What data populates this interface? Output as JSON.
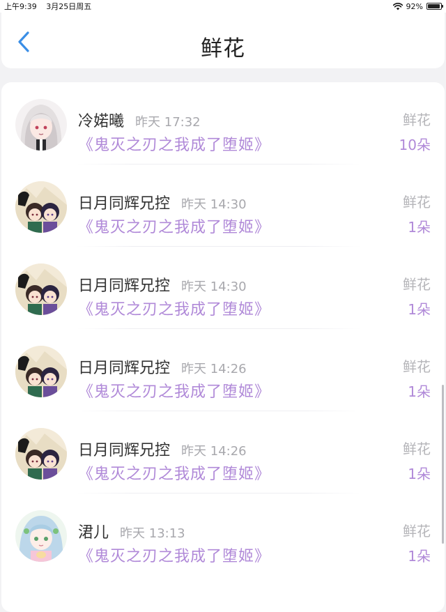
{
  "status_bar": {
    "time": "上午9:39",
    "date": "3月25日周五",
    "battery": "92%",
    "battery_level": 0.92
  },
  "nav": {
    "title": "鲜花",
    "back_icon": "chevron-left-icon",
    "accent_color": "#3a8ee6"
  },
  "rows": [
    {
      "user": "冷婼曦",
      "time": "昨天 17:32",
      "book": "《鬼灭之刃之我成了堕姬》",
      "type": "鲜花",
      "count": "10朵",
      "avatar": "avatar-white-hair-girl"
    },
    {
      "user": "日月同辉兄控",
      "time": "昨天 14:30",
      "book": "《鬼灭之刃之我成了堕姬》",
      "type": "鲜花",
      "count": "1朵",
      "avatar": "avatar-two-chibi"
    },
    {
      "user": "日月同辉兄控",
      "time": "昨天 14:30",
      "book": "《鬼灭之刃之我成了堕姬》",
      "type": "鲜花",
      "count": "1朵",
      "avatar": "avatar-two-chibi"
    },
    {
      "user": "日月同辉兄控",
      "time": "昨天 14:26",
      "book": "《鬼灭之刃之我成了堕姬》",
      "type": "鲜花",
      "count": "1朵",
      "avatar": "avatar-two-chibi"
    },
    {
      "user": "日月同辉兄控",
      "time": "昨天 14:26",
      "book": "《鬼灭之刃之我成了堕姬》",
      "type": "鲜花",
      "count": "1朵",
      "avatar": "avatar-two-chibi"
    },
    {
      "user": "涒儿",
      "time": "昨天 13:13",
      "book": "《鬼灭之刃之我成了堕姬》",
      "type": "鲜花",
      "count": "1朵",
      "avatar": "avatar-blue-hair-girl"
    }
  ],
  "colors": {
    "book_title": "#b089d8",
    "count": "#b089d8",
    "secondary_text": "#a8a8ad",
    "background": "#f2f2f4"
  }
}
